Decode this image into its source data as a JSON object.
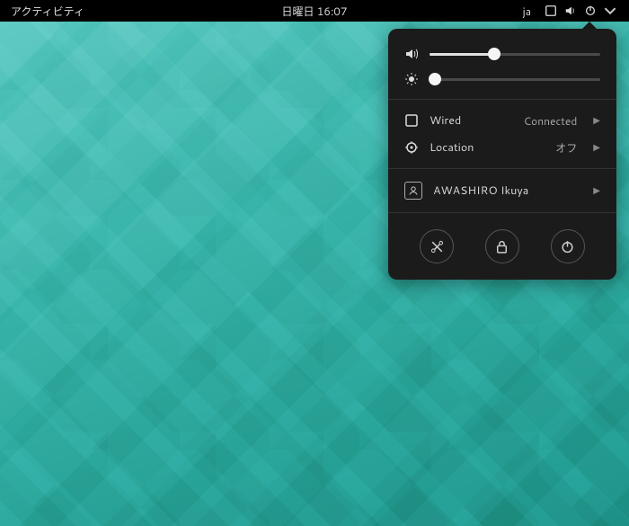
{
  "topbar": {
    "activities": "アクティビティ",
    "datetime": "日曜日 16:07",
    "ime": "ja"
  },
  "panel": {
    "volume_pct": 38,
    "brightness_pct": 3,
    "network": {
      "label": "Wired",
      "status": "Connected"
    },
    "location": {
      "label": "Location",
      "status": "オフ"
    },
    "user": {
      "name": "AWASHIRO Ikuya"
    }
  }
}
